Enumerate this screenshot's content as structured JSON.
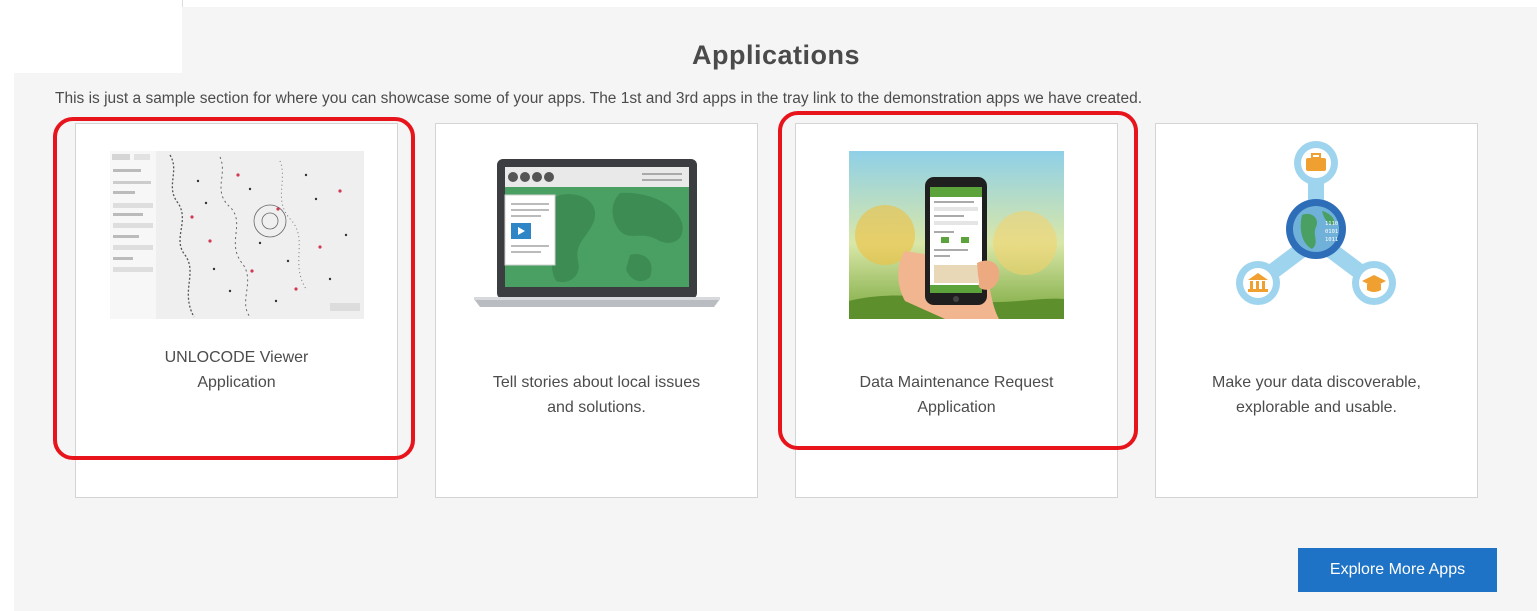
{
  "section": {
    "title": "Applications",
    "description": "This is just a sample section for where you can showcase some of your apps. The 1st and 3rd apps in the tray link to the demonstration apps we have created."
  },
  "cards": [
    {
      "caption_line1": "UNLOCODE Viewer",
      "caption_line2": "Application",
      "icon": "map-viewer-thumbnail"
    },
    {
      "caption_line1": "Tell stories about local issues",
      "caption_line2": "and solutions.",
      "icon": "story-map-laptop-thumbnail"
    },
    {
      "caption_line1": "Data Maintenance Request",
      "caption_line2": "Application",
      "icon": "phone-in-hand-thumbnail"
    },
    {
      "caption_line1": "Make your data discoverable,",
      "caption_line2": "explorable and usable.",
      "icon": "data-hub-globe-thumbnail"
    }
  ],
  "explore_button": {
    "label": "Explore More Apps"
  },
  "colors": {
    "accent": "#1e73c6",
    "highlight": "#e8141b",
    "map_green": "#4aa063",
    "hub_blue": "#7fc3e6"
  }
}
